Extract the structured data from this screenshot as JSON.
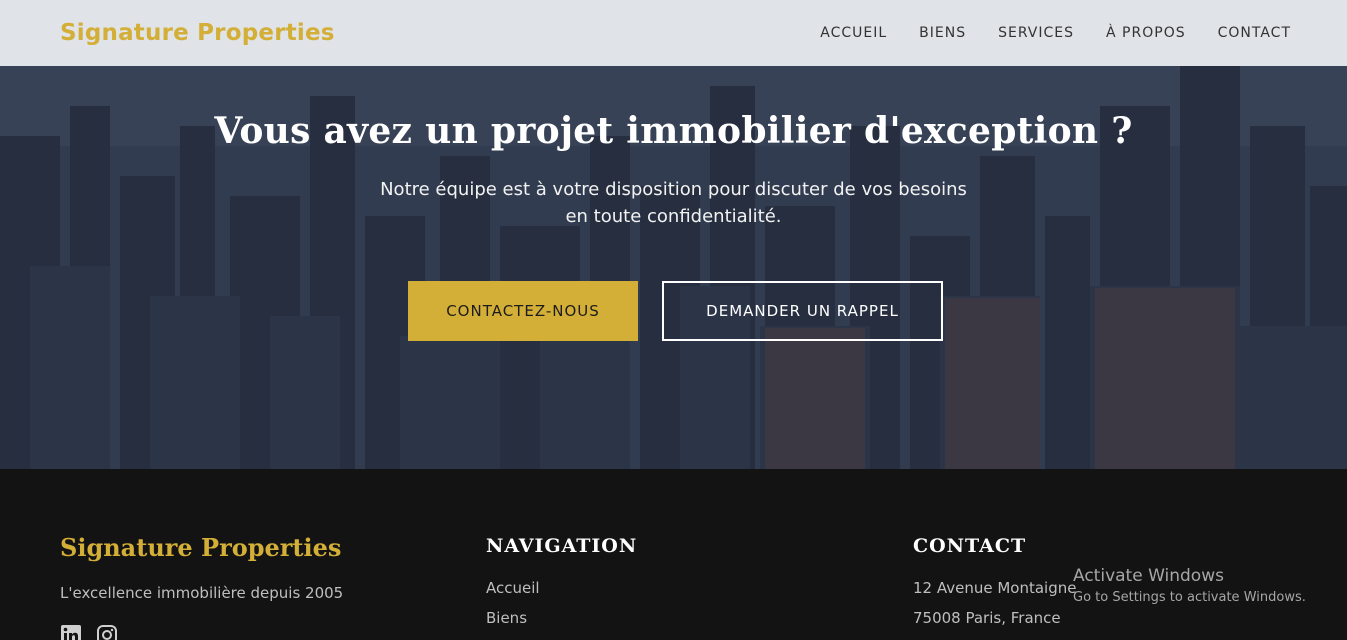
{
  "header": {
    "logo": "Signature Properties",
    "nav": [
      "ACCUEIL",
      "BIENS",
      "SERVICES",
      "À PROPOS",
      "CONTACT"
    ]
  },
  "hero": {
    "title": "Vous avez un projet immobilier d'exception ?",
    "subtitle_line1": "Notre équipe est à votre disposition pour discuter de vos besoins",
    "subtitle_line2": "en toute confidentialité.",
    "primary_button": "CONTACTEZ-NOUS",
    "secondary_button": "DEMANDER UN RAPPEL",
    "background": "city-skyline-aerial-image"
  },
  "footer": {
    "brand": "Signature Properties",
    "tagline": "L'excellence immobilière depuis 2005",
    "social_icons": [
      "linkedin-icon",
      "instagram-icon"
    ],
    "navigation": {
      "heading": "NAVIGATION",
      "links": [
        "Accueil",
        "Biens"
      ]
    },
    "contact": {
      "heading": "CONTACT",
      "lines": [
        "12 Avenue Montaigne",
        "75008 Paris, France"
      ]
    }
  },
  "watermark": {
    "line1": "Activate Windows",
    "line2": "Go to Settings to activate Windows."
  },
  "colors": {
    "accent": "#d4af37",
    "footer_bg": "#131313",
    "header_bg": "#e9ecf0"
  }
}
